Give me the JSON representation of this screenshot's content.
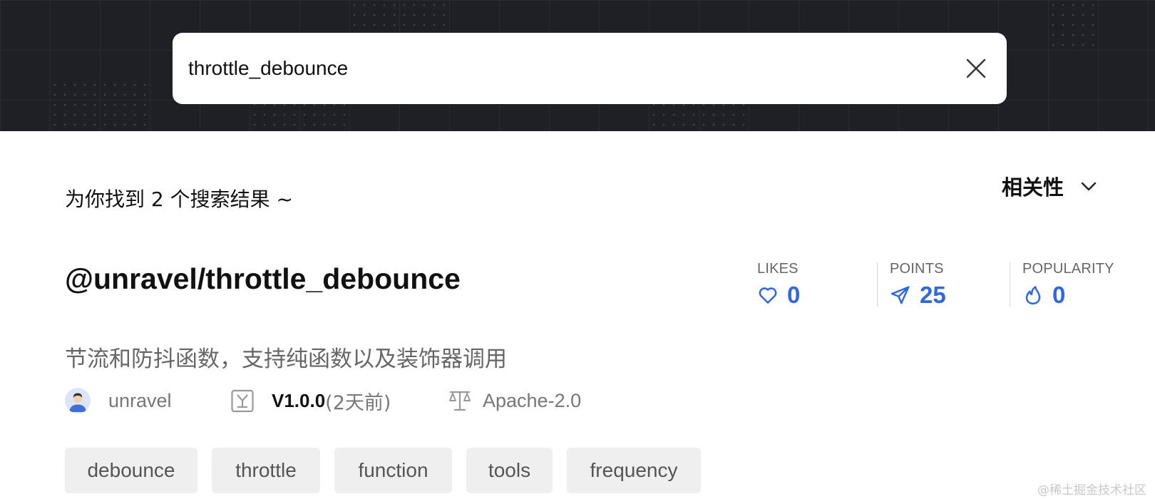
{
  "search": {
    "query": "throttle_debounce"
  },
  "results": {
    "summary": "为你找到 2 个搜索结果 ~",
    "sort_label": "相关性"
  },
  "package": {
    "name": "@unravel/throttle_debounce",
    "description": "节流和防抖函数，支持纯函数以及装饰器调用",
    "stats": {
      "likes": {
        "label": "LIKES",
        "value": "0",
        "icon": "heart-icon"
      },
      "points": {
        "label": "POINTS",
        "value": "25",
        "icon": "paper-plane-icon"
      },
      "popularity": {
        "label": "POPULARITY",
        "value": "0",
        "icon": "flame-icon"
      }
    },
    "author": "unravel",
    "version": "V1.0.0",
    "version_ago": "(2天前)",
    "license": "Apache-2.0",
    "tags": [
      "debounce",
      "throttle",
      "function",
      "tools",
      "frequency"
    ]
  },
  "watermark": "@稀土掘金技术社区",
  "colors": {
    "accent": "#3168e0",
    "header_bg": "#1f2026",
    "tag_bg": "#efefef"
  }
}
